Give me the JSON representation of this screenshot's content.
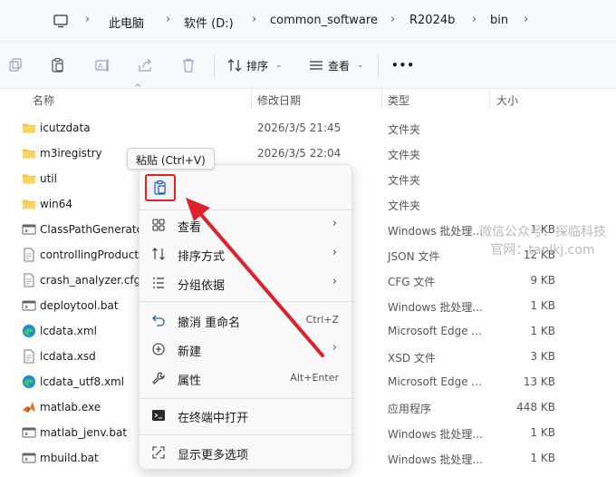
{
  "address_bar": {
    "crumbs": [
      "此电脑",
      "软件 (D:)",
      "common_software",
      "R2024b",
      "bin"
    ]
  },
  "command_bar": {
    "sort_label": "排序",
    "view_label": "查看",
    "more_label": "•••"
  },
  "columns": {
    "name": "名称",
    "date": "修改日期",
    "type": "类型",
    "size": "大小"
  },
  "files": [
    {
      "name": "icutzdata",
      "date": "2026/3/5 21:45",
      "type": "文件夹",
      "size": "",
      "icon": "folder-icon"
    },
    {
      "name": "m3iregistry",
      "date": "2026/3/5 22:04",
      "type": "文件夹",
      "size": "",
      "icon": "folder-icon"
    },
    {
      "name": "util",
      "date": "",
      "type": "文件夹",
      "size": "",
      "icon": "folder-icon"
    },
    {
      "name": "win64",
      "date": "",
      "type": "文件夹",
      "size": "",
      "icon": "folder-icon"
    },
    {
      "name": "ClassPathGenerato",
      "date": "",
      "type": "Windows 批处理...",
      "size": "1 KB",
      "icon": "batch-file-icon"
    },
    {
      "name": "controllingProduct",
      "date": "",
      "type": "JSON 文件",
      "size": "12 KB",
      "icon": "text-file-icon"
    },
    {
      "name": "crash_analyzer.cfg",
      "date": "",
      "type": "CFG 文件",
      "size": "9 KB",
      "icon": "text-file-icon"
    },
    {
      "name": "deploytool.bat",
      "date": "",
      "type": "Windows 批处理...",
      "size": "1 KB",
      "icon": "batch-file-icon"
    },
    {
      "name": "lcdata.xml",
      "date": "",
      "type": "Microsoft Edge ...",
      "size": "1 KB",
      "icon": "edge-icon"
    },
    {
      "name": "lcdata.xsd",
      "date": "",
      "type": "XSD 文件",
      "size": "3 KB",
      "icon": "text-file-icon"
    },
    {
      "name": "lcdata_utf8.xml",
      "date": "",
      "type": "Microsoft Edge ...",
      "size": "13 KB",
      "icon": "edge-icon"
    },
    {
      "name": "matlab.exe",
      "date": "",
      "type": "应用程序",
      "size": "448 KB",
      "icon": "matlab-icon"
    },
    {
      "name": "matlab_jenv.bat",
      "date": "",
      "type": "Windows 批处理...",
      "size": "1 KB",
      "icon": "batch-file-icon"
    },
    {
      "name": "mbuild.bat",
      "date": "",
      "type": "Windows 批处理...",
      "size": "1 KB",
      "icon": "batch-file-icon"
    }
  ],
  "tooltip": "粘贴 (Ctrl+V)",
  "context_menu": {
    "view": "查看",
    "sort_by": "排序方式",
    "group_by": "分组依据",
    "undo": "撤消 重命名",
    "undo_accel": "Ctrl+Z",
    "new": "新建",
    "properties": "属性",
    "properties_accel": "Alt+Enter",
    "open_terminal": "在终端中打开",
    "show_more": "显示更多选项"
  },
  "watermark": {
    "line1": "微信公众号：探临科技",
    "line2": "官网：tanlkj.com"
  },
  "colors": {
    "accent": "#e0202a",
    "folder": "#f5c342"
  }
}
